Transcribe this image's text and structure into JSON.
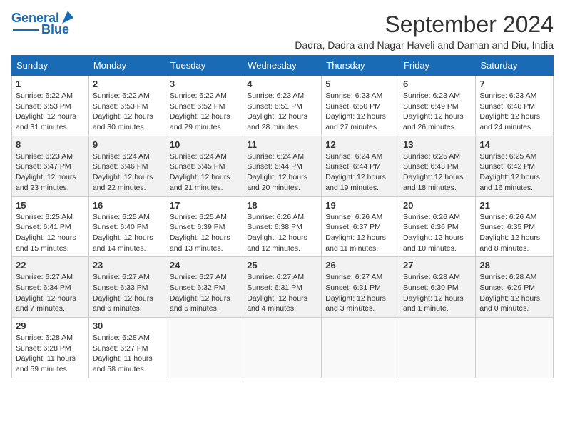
{
  "logo": {
    "line1": "General",
    "line2": "Blue"
  },
  "title": "September 2024",
  "subtitle": "Dadra, Dadra and Nagar Haveli and Daman and Diu, India",
  "days_of_week": [
    "Sunday",
    "Monday",
    "Tuesday",
    "Wednesday",
    "Thursday",
    "Friday",
    "Saturday"
  ],
  "weeks": [
    [
      {
        "day": 1,
        "info": "Sunrise: 6:22 AM\nSunset: 6:53 PM\nDaylight: 12 hours\nand 31 minutes."
      },
      {
        "day": 2,
        "info": "Sunrise: 6:22 AM\nSunset: 6:53 PM\nDaylight: 12 hours\nand 30 minutes."
      },
      {
        "day": 3,
        "info": "Sunrise: 6:22 AM\nSunset: 6:52 PM\nDaylight: 12 hours\nand 29 minutes."
      },
      {
        "day": 4,
        "info": "Sunrise: 6:23 AM\nSunset: 6:51 PM\nDaylight: 12 hours\nand 28 minutes."
      },
      {
        "day": 5,
        "info": "Sunrise: 6:23 AM\nSunset: 6:50 PM\nDaylight: 12 hours\nand 27 minutes."
      },
      {
        "day": 6,
        "info": "Sunrise: 6:23 AM\nSunset: 6:49 PM\nDaylight: 12 hours\nand 26 minutes."
      },
      {
        "day": 7,
        "info": "Sunrise: 6:23 AM\nSunset: 6:48 PM\nDaylight: 12 hours\nand 24 minutes."
      }
    ],
    [
      {
        "day": 8,
        "info": "Sunrise: 6:23 AM\nSunset: 6:47 PM\nDaylight: 12 hours\nand 23 minutes."
      },
      {
        "day": 9,
        "info": "Sunrise: 6:24 AM\nSunset: 6:46 PM\nDaylight: 12 hours\nand 22 minutes."
      },
      {
        "day": 10,
        "info": "Sunrise: 6:24 AM\nSunset: 6:45 PM\nDaylight: 12 hours\nand 21 minutes."
      },
      {
        "day": 11,
        "info": "Sunrise: 6:24 AM\nSunset: 6:44 PM\nDaylight: 12 hours\nand 20 minutes."
      },
      {
        "day": 12,
        "info": "Sunrise: 6:24 AM\nSunset: 6:44 PM\nDaylight: 12 hours\nand 19 minutes."
      },
      {
        "day": 13,
        "info": "Sunrise: 6:25 AM\nSunset: 6:43 PM\nDaylight: 12 hours\nand 18 minutes."
      },
      {
        "day": 14,
        "info": "Sunrise: 6:25 AM\nSunset: 6:42 PM\nDaylight: 12 hours\nand 16 minutes."
      }
    ],
    [
      {
        "day": 15,
        "info": "Sunrise: 6:25 AM\nSunset: 6:41 PM\nDaylight: 12 hours\nand 15 minutes."
      },
      {
        "day": 16,
        "info": "Sunrise: 6:25 AM\nSunset: 6:40 PM\nDaylight: 12 hours\nand 14 minutes."
      },
      {
        "day": 17,
        "info": "Sunrise: 6:25 AM\nSunset: 6:39 PM\nDaylight: 12 hours\nand 13 minutes."
      },
      {
        "day": 18,
        "info": "Sunrise: 6:26 AM\nSunset: 6:38 PM\nDaylight: 12 hours\nand 12 minutes."
      },
      {
        "day": 19,
        "info": "Sunrise: 6:26 AM\nSunset: 6:37 PM\nDaylight: 12 hours\nand 11 minutes."
      },
      {
        "day": 20,
        "info": "Sunrise: 6:26 AM\nSunset: 6:36 PM\nDaylight: 12 hours\nand 10 minutes."
      },
      {
        "day": 21,
        "info": "Sunrise: 6:26 AM\nSunset: 6:35 PM\nDaylight: 12 hours\nand 8 minutes."
      }
    ],
    [
      {
        "day": 22,
        "info": "Sunrise: 6:27 AM\nSunset: 6:34 PM\nDaylight: 12 hours\nand 7 minutes."
      },
      {
        "day": 23,
        "info": "Sunrise: 6:27 AM\nSunset: 6:33 PM\nDaylight: 12 hours\nand 6 minutes."
      },
      {
        "day": 24,
        "info": "Sunrise: 6:27 AM\nSunset: 6:32 PM\nDaylight: 12 hours\nand 5 minutes."
      },
      {
        "day": 25,
        "info": "Sunrise: 6:27 AM\nSunset: 6:31 PM\nDaylight: 12 hours\nand 4 minutes."
      },
      {
        "day": 26,
        "info": "Sunrise: 6:27 AM\nSunset: 6:31 PM\nDaylight: 12 hours\nand 3 minutes."
      },
      {
        "day": 27,
        "info": "Sunrise: 6:28 AM\nSunset: 6:30 PM\nDaylight: 12 hours\nand 1 minute."
      },
      {
        "day": 28,
        "info": "Sunrise: 6:28 AM\nSunset: 6:29 PM\nDaylight: 12 hours\nand 0 minutes."
      }
    ],
    [
      {
        "day": 29,
        "info": "Sunrise: 6:28 AM\nSunset: 6:28 PM\nDaylight: 11 hours\nand 59 minutes."
      },
      {
        "day": 30,
        "info": "Sunrise: 6:28 AM\nSunset: 6:27 PM\nDaylight: 11 hours\nand 58 minutes."
      },
      null,
      null,
      null,
      null,
      null
    ]
  ]
}
